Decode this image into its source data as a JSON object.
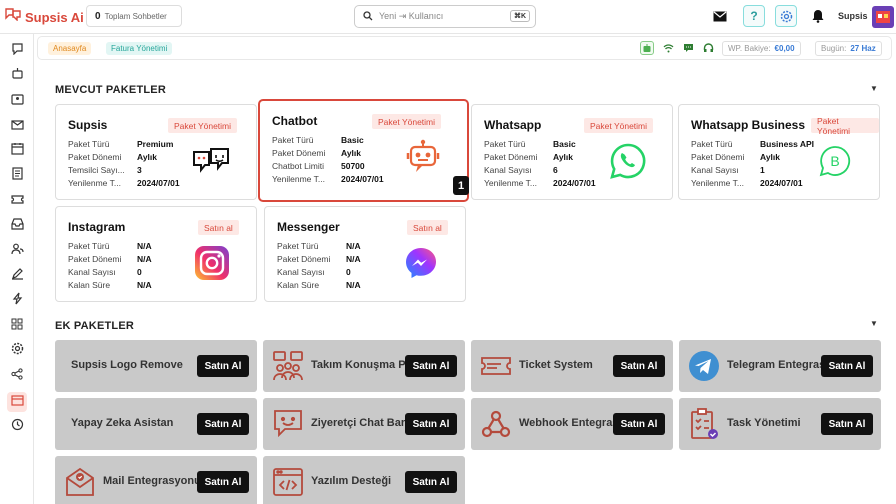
{
  "app": {
    "name": "Supsis Ai"
  },
  "header": {
    "chat_count_value": "0",
    "chat_count_label": "Toplam Sohbetler",
    "search_placeholder": "Yeni ⇥ Kullanıcı",
    "search_shortcut": "⌘K",
    "user_name": "Supsis"
  },
  "breadcrumb": {
    "home": "Anasayfa",
    "current": "Fatura Yönetimi"
  },
  "status": {
    "wp_balance_label": "WP. Bakiye:",
    "wp_balance_value": "€0,00",
    "today_label": "Bugün:",
    "today_value": "27 Haz"
  },
  "sections": {
    "current": "MEVCUT PAKETLER",
    "extra": "EK PAKETLER"
  },
  "packages": [
    {
      "title": "Supsis",
      "action": "Paket Yönetimi",
      "icon": "supsis-chat-icon",
      "rows": [
        {
          "k": "Paket Türü",
          "v": "Premium"
        },
        {
          "k": "Paket Dönemi",
          "v": "Aylık"
        },
        {
          "k": "Temsilci Sayı...",
          "v": "3"
        },
        {
          "k": "Yenilenme T...",
          "v": "2024/07/01"
        }
      ]
    },
    {
      "title": "Chatbot",
      "action": "Paket Yönetimi",
      "icon": "robot-icon",
      "rows": [
        {
          "k": "Paket Türü",
          "v": "Basic"
        },
        {
          "k": "Paket Dönemi",
          "v": "Aylık"
        },
        {
          "k": "Chatbot Limiti",
          "v": "50700"
        },
        {
          "k": "Yenilenme T...",
          "v": "2024/07/01"
        }
      ]
    },
    {
      "title": "Whatsapp",
      "action": "Paket Yönetimi",
      "icon": "whatsapp-icon",
      "rows": [
        {
          "k": "Paket Türü",
          "v": "Basic"
        },
        {
          "k": "Paket Dönemi",
          "v": "Aylık"
        },
        {
          "k": "Kanal Sayısı",
          "v": "6"
        },
        {
          "k": "Yenilenme T...",
          "v": "2024/07/01"
        }
      ]
    },
    {
      "title": "Whatsapp Business",
      "action": "Paket Yönetimi",
      "icon": "whatsapp-business-icon",
      "rows": [
        {
          "k": "Paket Türü",
          "v": "Business API"
        },
        {
          "k": "Paket Dönemi",
          "v": "Aylık"
        },
        {
          "k": "Kanal Sayısı",
          "v": "1"
        },
        {
          "k": "Yenilenme T...",
          "v": "2024/07/01"
        }
      ]
    },
    {
      "title": "Instagram",
      "action": "Satın al",
      "icon": "instagram-icon",
      "rows": [
        {
          "k": "Paket Türü",
          "v": "N/A"
        },
        {
          "k": "Paket Dönemi",
          "v": "N/A"
        },
        {
          "k": "Kanal Sayısı",
          "v": "0"
        },
        {
          "k": "Kalan Süre",
          "v": "N/A"
        }
      ]
    },
    {
      "title": "Messenger",
      "action": "Satın al",
      "icon": "messenger-icon",
      "rows": [
        {
          "k": "Paket Türü",
          "v": "N/A"
        },
        {
          "k": "Paket Dönemi",
          "v": "N/A"
        },
        {
          "k": "Kanal Sayısı",
          "v": "0"
        },
        {
          "k": "Kalan Süre",
          "v": "N/A"
        }
      ]
    }
  ],
  "selected_badge": "1",
  "extras": [
    {
      "label": "Supsis Logo Remove",
      "button": "Satın Al",
      "icon": ""
    },
    {
      "label": "Takım Konuşma Paketi",
      "button": "Satın Al",
      "icon": "team-chat-icon"
    },
    {
      "label": "Ticket System",
      "button": "Satın Al",
      "icon": "ticket-icon"
    },
    {
      "label": "Telegram Entegrasyonu",
      "button": "Satın Al",
      "icon": "telegram-icon"
    },
    {
      "label": "Yapay Zeka Asistan",
      "button": "Satın Al",
      "icon": ""
    },
    {
      "label": "Ziyeretçi Chat Bar",
      "button": "Satın Al",
      "icon": "chat-bar-icon"
    },
    {
      "label": "Webhook Entegrasyonu",
      "button": "Satın Al",
      "icon": "webhook-icon"
    },
    {
      "label": "Task Yönetimi",
      "button": "Satın Al",
      "icon": "task-icon"
    },
    {
      "label": "Mail Entegrasyonu",
      "button": "Satın Al",
      "icon": "mail-icon"
    },
    {
      "label": "Yazılım Desteği",
      "button": "Satın Al",
      "icon": "code-icon"
    }
  ],
  "colors": {
    "brand": "#d9483b",
    "teal": "#26a69a",
    "whatsapp": "#25d366",
    "extra_bg": "#c9c9c9"
  }
}
